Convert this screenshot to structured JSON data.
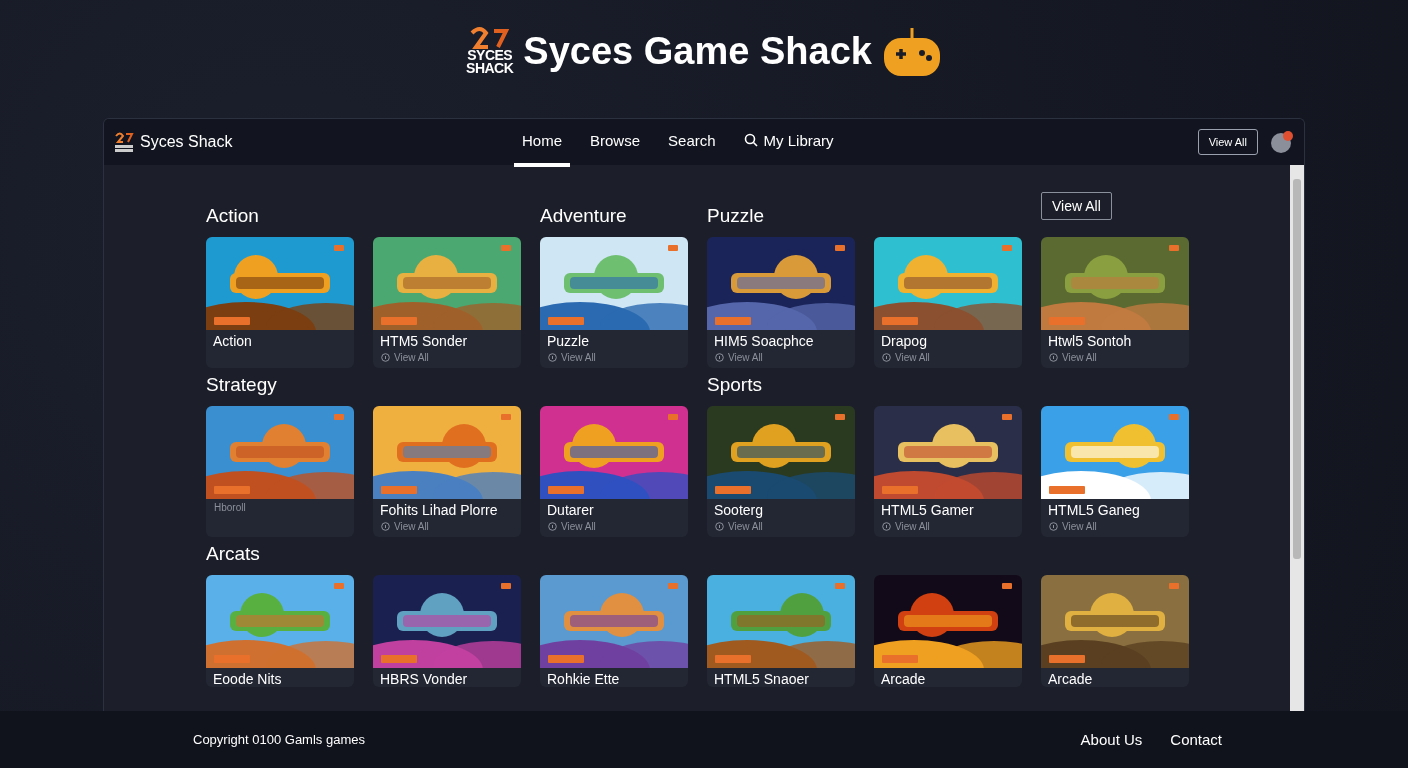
{
  "header": {
    "logo_lines": [
      "SYCES",
      "SHACK"
    ],
    "title": "Syces Game Shack"
  },
  "nav": {
    "brand": "Syces Shack",
    "tabs": [
      {
        "label": "Home",
        "selected": true,
        "icon": false
      },
      {
        "label": "Browse",
        "selected": false,
        "icon": false
      },
      {
        "label": "Search",
        "selected": false,
        "icon": false
      },
      {
        "label": "My Library",
        "selected": false,
        "icon": true
      }
    ],
    "button": "View All"
  },
  "rows": [
    {
      "action": "View All",
      "cards": [
        {
          "section": "Action",
          "title": "Action"
        },
        {
          "title": "HTM5 Sonder",
          "meta": {
            "kind": "link",
            "text": "View All"
          }
        },
        {
          "section": "Adventure",
          "title": "Puzzle",
          "meta": {
            "kind": "link",
            "text": "View All"
          }
        },
        {
          "section": "Puzzle",
          "title": "HIM5 Soacphce",
          "meta": {
            "kind": "link",
            "text": "View All"
          }
        },
        {
          "title": "Drapog",
          "meta": {
            "kind": "link",
            "text": "View All"
          }
        },
        {
          "title": "Htwl5 Sontoh",
          "meta": {
            "kind": "link",
            "text": "View All"
          }
        }
      ]
    },
    {
      "cards": [
        {
          "section": "Strategy",
          "meta": {
            "kind": "caption",
            "text": "Hboroll"
          }
        },
        {
          "title": "Fohits Lihad Plorre",
          "meta": {
            "kind": "link",
            "text": "View All"
          }
        },
        {
          "title": "Dutarer",
          "meta": {
            "kind": "link",
            "text": "View All"
          }
        },
        {
          "section": "Sports",
          "title": "Sooterg",
          "meta": {
            "kind": "link",
            "text": "View All"
          }
        },
        {
          "title": "HTML5 Gamer",
          "meta": {
            "kind": "link",
            "text": "View All"
          }
        },
        {
          "title": "HTML5 Ganeg",
          "meta": {
            "kind": "link",
            "text": "View All"
          }
        }
      ]
    },
    {
      "cards": [
        {
          "section": "Arcats",
          "title": "Eoode Nits"
        },
        {
          "title": "HBRS Vonder"
        },
        {
          "title": "Rohkie Ette"
        },
        {
          "title": "HTML5 Snaoer"
        },
        {
          "title": "Arcade"
        },
        {
          "title": "Arcade"
        }
      ]
    }
  ],
  "footer": {
    "copyright": "Copyright 0100 Gamls games",
    "links": [
      "About Us",
      "Contact"
    ]
  }
}
